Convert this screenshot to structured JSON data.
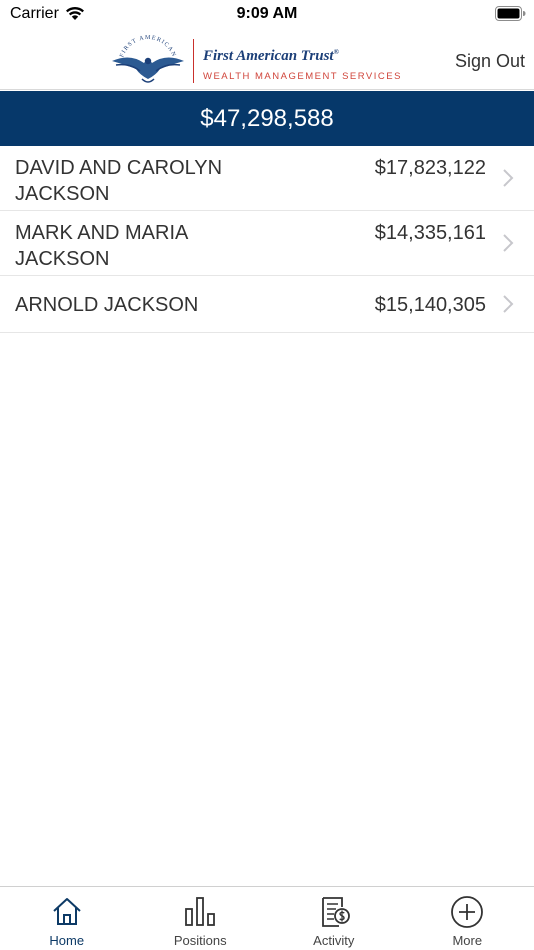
{
  "status_bar": {
    "carrier": "Carrier",
    "time": "9:09 AM"
  },
  "header": {
    "logo_arc_text": "FIRST AMERICAN",
    "brand_name": "First American Trust",
    "brand_mark": "®",
    "tagline": "WEALTH MANAGEMENT SERVICES",
    "sign_out_label": "Sign Out"
  },
  "total": {
    "value": "$47,298,588"
  },
  "accounts": [
    {
      "name": "DAVID AND CAROLYN JACKSON",
      "value": "$17,823,122"
    },
    {
      "name": "MARK AND MARIA JACKSON",
      "value": "$14,335,161"
    },
    {
      "name": "ARNOLD JACKSON",
      "value": "$15,140,305"
    }
  ],
  "tabs": [
    {
      "label": "Home",
      "icon": "home-icon",
      "active": true
    },
    {
      "label": "Positions",
      "icon": "bar-chart-icon",
      "active": false
    },
    {
      "label": "Activity",
      "icon": "statement-icon",
      "active": false
    },
    {
      "label": "More",
      "icon": "plus-circle-icon",
      "active": false
    }
  ],
  "colors": {
    "banner": "#06386a",
    "brand": "#1c3f78",
    "tagline": "#d0453b",
    "active_tab": "#0d3a66"
  }
}
